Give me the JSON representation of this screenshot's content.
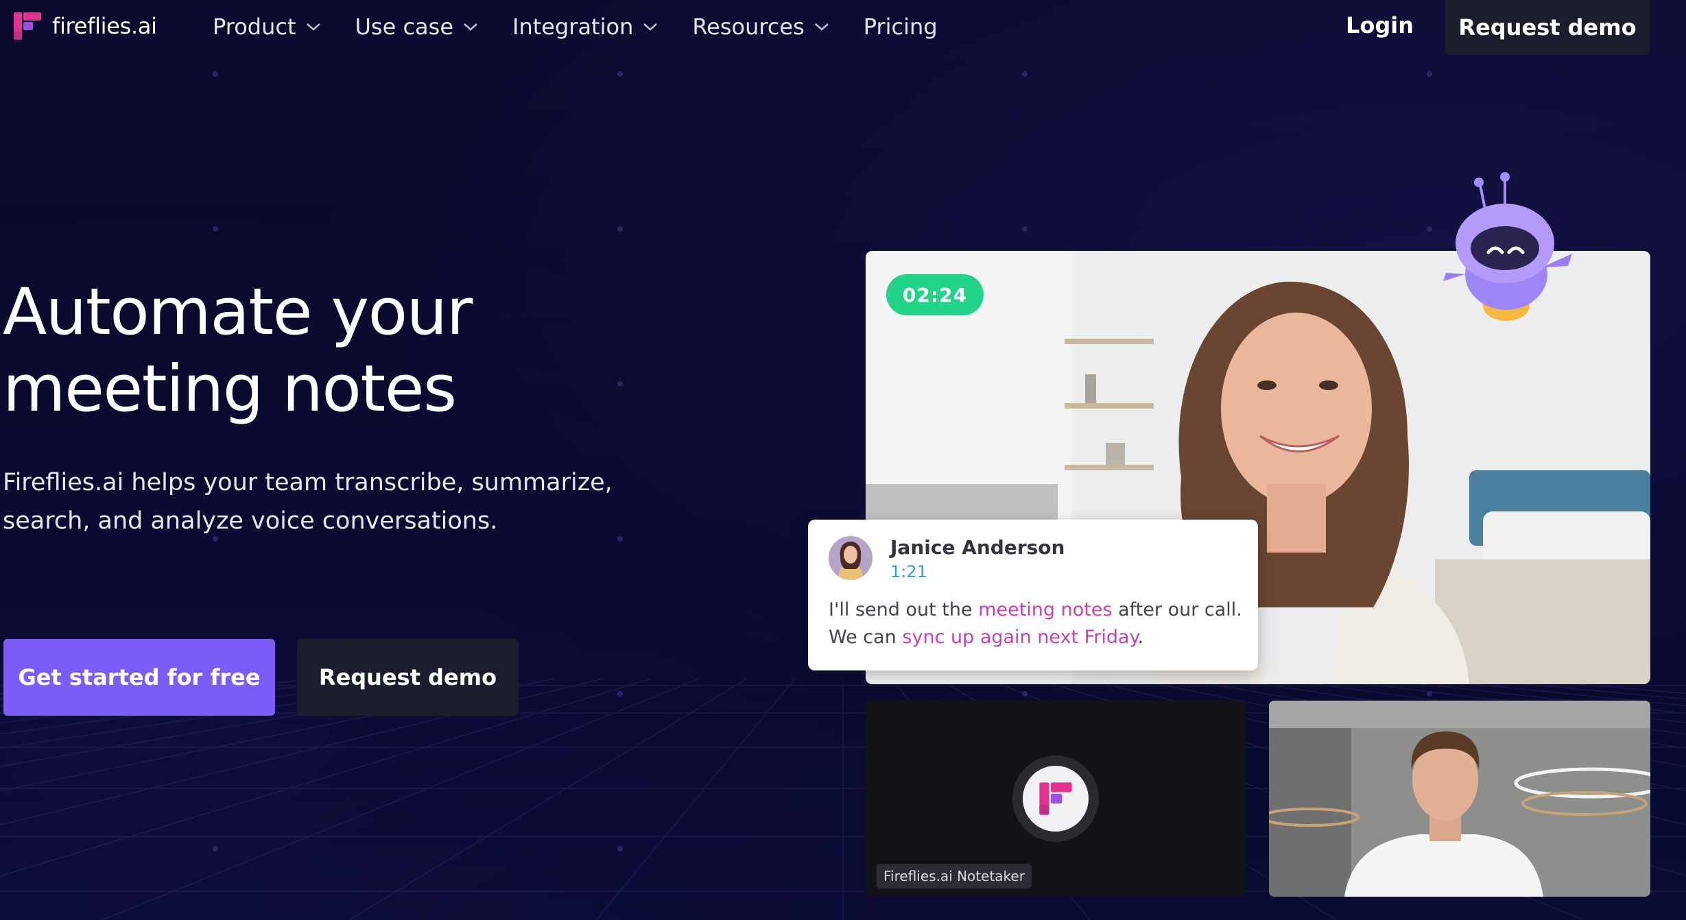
{
  "brand": {
    "name": "fireflies.ai",
    "colors": {
      "primary": "#7b5cf6",
      "pink": "#e0338f",
      "green": "#22d38a",
      "background": "#0a0a2a"
    }
  },
  "nav": {
    "items": [
      {
        "label": "Product",
        "has_dropdown": true
      },
      {
        "label": "Use case",
        "has_dropdown": true
      },
      {
        "label": "Integration",
        "has_dropdown": true
      },
      {
        "label": "Resources",
        "has_dropdown": true
      },
      {
        "label": "Pricing",
        "has_dropdown": false
      }
    ],
    "login_label": "Login",
    "demo_label": "Request demo"
  },
  "hero": {
    "title_line1": "Automate your",
    "title_line2": "meeting notes",
    "subtitle_line1": "Fireflies.ai helps your team transcribe, summarize,",
    "subtitle_line2": "search, and analyze voice conversations.",
    "primary_cta": "Get started for free",
    "secondary_cta": "Request demo"
  },
  "meeting": {
    "timer": "02:24",
    "transcript": {
      "speaker": "Janice Anderson",
      "timestamp": "1:21",
      "text_parts": [
        {
          "text": "I'll send out the ",
          "highlight": false
        },
        {
          "text": "meeting notes",
          "highlight": true
        },
        {
          "text": " after our call. We can ",
          "highlight": false
        },
        {
          "text": "sync up again next Friday",
          "highlight": true
        },
        {
          "text": ".",
          "highlight": false
        }
      ]
    },
    "notetaker_label": "Fireflies.ai Notetaker"
  }
}
